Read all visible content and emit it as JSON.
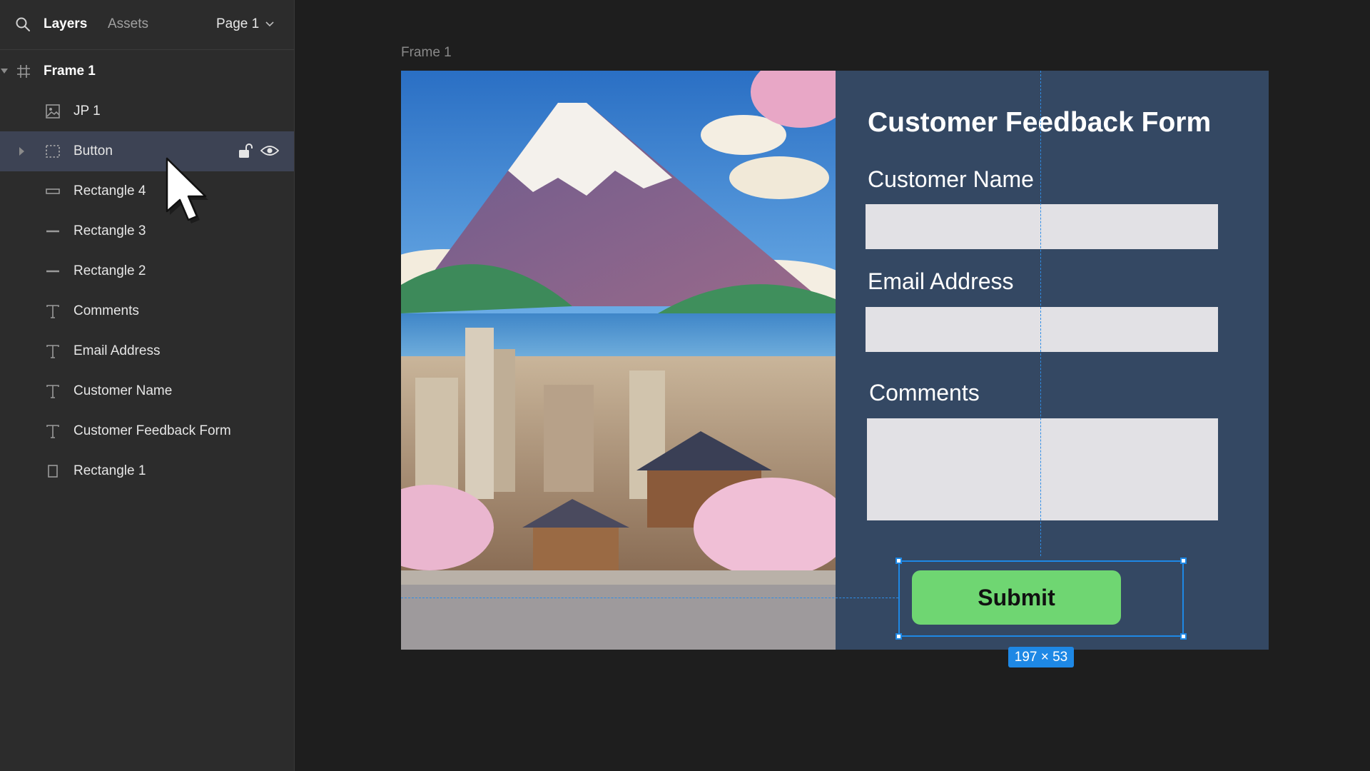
{
  "sidebar": {
    "tabs": {
      "layers": "Layers",
      "assets": "Assets"
    },
    "page_selector": "Page 1",
    "layers": [
      {
        "label": "Frame 1",
        "icon": "frame-icon"
      },
      {
        "label": "JP 1",
        "icon": "image-icon"
      },
      {
        "label": "Button",
        "icon": "group-icon",
        "selected": true
      },
      {
        "label": "Rectangle 4",
        "icon": "rectangle-icon"
      },
      {
        "label": "Rectangle 3",
        "icon": "line-icon"
      },
      {
        "label": "Rectangle 2",
        "icon": "line-icon"
      },
      {
        "label": "Comments",
        "icon": "text-icon"
      },
      {
        "label": "Email Address",
        "icon": "text-icon"
      },
      {
        "label": "Customer Name",
        "icon": "text-icon"
      },
      {
        "label": "Customer Feedback Form",
        "icon": "text-icon"
      },
      {
        "label": "Rectangle 1",
        "icon": "rectangle-icon"
      }
    ]
  },
  "canvas": {
    "frame_title": "Frame 1",
    "form": {
      "title": "Customer Feedback Form",
      "name_label": "Customer Name",
      "email_label": "Email Address",
      "comments_label": "Comments",
      "name_value": "",
      "email_value": "",
      "comments_value": "",
      "submit_label": "Submit"
    },
    "selection_size": "197 × 53"
  },
  "colors": {
    "canvas_bg": "#1e1e1e",
    "panel_bg": "#2c2c2c",
    "selected_row": "#3d4354",
    "form_bg": "#344863",
    "input_bg": "#e2e1e5",
    "submit_bg": "#6fd672",
    "selection_blue": "#1e88e5"
  }
}
